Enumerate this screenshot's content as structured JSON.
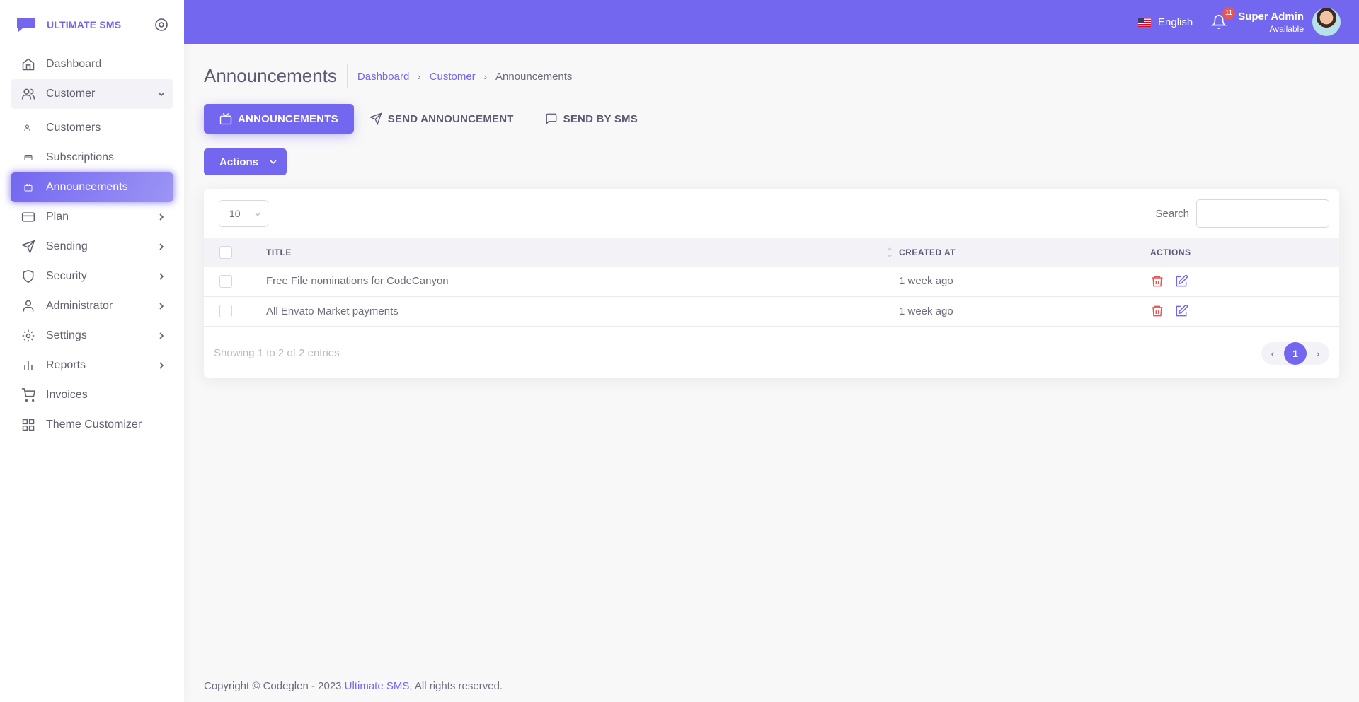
{
  "brand": {
    "name": "ULTIMATE SMS"
  },
  "colors": {
    "primary": "#7367f0",
    "danger": "#ea5455",
    "background": "#f8f8f8"
  },
  "sidebar": {
    "items": [
      {
        "label": "Dashboard",
        "icon": "home-icon"
      },
      {
        "label": "Customer",
        "icon": "users-icon",
        "open": true
      },
      {
        "label": "Customers",
        "icon": "circle-icon",
        "sub": true
      },
      {
        "label": "Subscriptions",
        "icon": "circle-icon",
        "sub": true
      },
      {
        "label": "Announcements",
        "icon": "circle-icon",
        "sub": true,
        "active": true
      },
      {
        "label": "Plan",
        "icon": "credit-card-icon"
      },
      {
        "label": "Sending",
        "icon": "send-icon"
      },
      {
        "label": "Security",
        "icon": "shield-icon"
      },
      {
        "label": "Administrator",
        "icon": "user-icon"
      },
      {
        "label": "Settings",
        "icon": "settings-icon"
      },
      {
        "label": "Reports",
        "icon": "bar-chart-icon"
      },
      {
        "label": "Invoices",
        "icon": "shopping-cart-icon"
      },
      {
        "label": "Theme Customizer",
        "icon": "grid-icon"
      }
    ]
  },
  "header": {
    "language": "English",
    "notifications": "11",
    "user_name": "Super Admin",
    "user_status": "Available"
  },
  "page": {
    "title": "Announcements",
    "breadcrumb": [
      "Dashboard",
      "Customer",
      "Announcements"
    ]
  },
  "tabs": [
    {
      "label": "ANNOUNCEMENTS",
      "icon": "tv-icon",
      "active": true
    },
    {
      "label": "SEND ANNOUNCEMENT",
      "icon": "send-icon"
    },
    {
      "label": "SEND BY SMS",
      "icon": "message-square-icon"
    }
  ],
  "actions_label": "Actions",
  "table": {
    "page_length": "10",
    "search_label": "Search",
    "search_value": "",
    "columns": [
      "TITLE",
      "CREATED AT",
      "ACTIONS"
    ],
    "rows": [
      {
        "title": "Free File nominations for CodeCanyon",
        "created_at": "1 week ago"
      },
      {
        "title": "All Envato Market payments",
        "created_at": "1 week ago"
      }
    ],
    "info": "Showing 1 to 2 of 2 entries",
    "current_page": "1"
  },
  "footer": {
    "prefix": "Copyright © Codeglen - 2023",
    "link": "Ultimate SMS",
    "suffix": ", All rights reserved."
  }
}
